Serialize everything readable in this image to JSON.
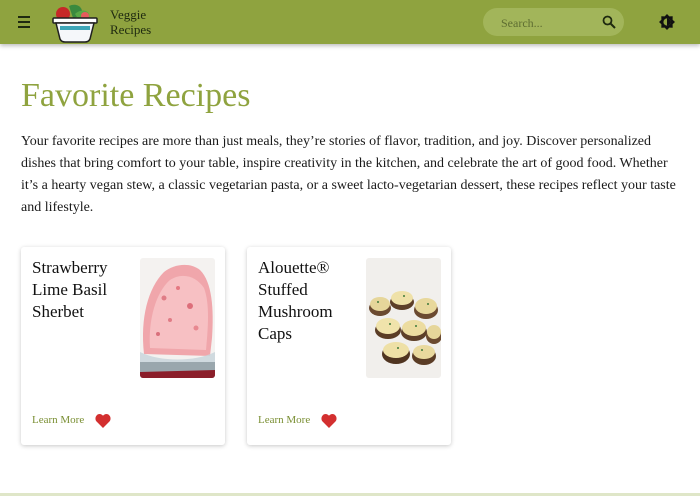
{
  "header": {
    "brand_line1": "Veggie",
    "brand_line2": "Recipes",
    "search_placeholder": "Search...",
    "bar_color": "#8fa33f",
    "icons": {
      "menu": "menu-icon",
      "logo": "salad-bowl-logo",
      "search": "search-icon",
      "theme": "brightness-icon"
    }
  },
  "main": {
    "title": "Favorite Recipes",
    "intro": "Your favorite recipes are more than just meals, they’re stories of flavor, tradition, and joy. Discover personalized dishes that bring comfort to your table, inspire creativity in the kitchen, and celebrate the art of good food. Whether it’s a hearty vegan stew, a classic vegetarian pasta, or a sweet lacto-vegetarian dessert, these recipes reflect your taste and lifestyle.",
    "cards": [
      {
        "title": "Strawberry Lime Basil Sherbet",
        "link": "Learn More",
        "favorite": true
      },
      {
        "title": "Alouette® Stuffed Mushroom Caps",
        "link": "Learn More",
        "favorite": true
      }
    ]
  },
  "colors": {
    "accent": "#8fa33f",
    "heart": "#d32f2f"
  }
}
